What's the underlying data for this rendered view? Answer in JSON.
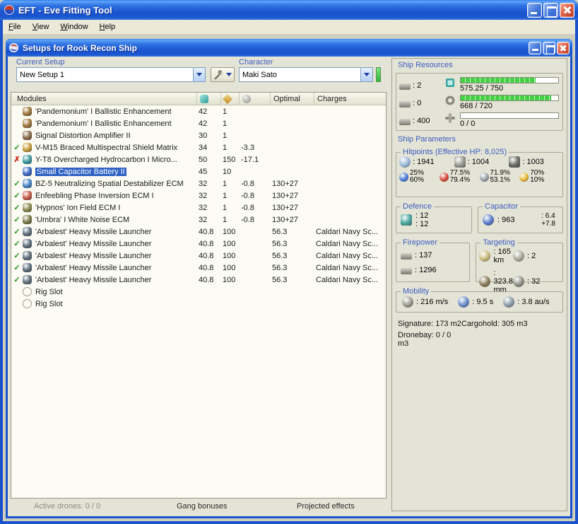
{
  "colors": {
    "selection": "#2F62C4",
    "ok": "#189418",
    "bad": "#C82814",
    "bargreen": "#44D044",
    "labelblue": "#3C5CC0"
  },
  "window": {
    "title": "EFT - Eve Fitting Tool"
  },
  "menu": {
    "items": [
      {
        "label": "File"
      },
      {
        "label": "View"
      },
      {
        "label": "Window"
      },
      {
        "label": "Help"
      }
    ]
  },
  "setup_window": {
    "title": "Setups for Rook Recon Ship",
    "current_setup": {
      "label": "Current Setup",
      "value": "New Setup 1"
    },
    "character": {
      "label": "Character",
      "value": "Maki Sato"
    }
  },
  "modules": {
    "headers": {
      "name": "Modules",
      "optimal": "Optimal",
      "charges": "Charges"
    },
    "status_glyphs": {
      "ok": "✓",
      "bad": "✗"
    },
    "rows": [
      {
        "status": "",
        "icon": "module-icon",
        "icon_color": "#A0783C",
        "name": "'Pandemonium' I Ballistic Enhancement",
        "cpu": "42",
        "pg": "1",
        "cap": "",
        "optimal": "",
        "charges": "",
        "selected": false
      },
      {
        "status": "",
        "icon": "module-icon",
        "icon_color": "#A0783C",
        "name": "'Pandemonium' I Ballistic Enhancement",
        "cpu": "42",
        "pg": "1",
        "cap": "",
        "optimal": "",
        "charges": "",
        "selected": false
      },
      {
        "status": "",
        "icon": "module-icon",
        "icon_color": "#8A6A4A",
        "name": "Signal Distortion Amplifier II",
        "cpu": "30",
        "pg": "1",
        "cap": "",
        "optimal": "",
        "charges": "",
        "selected": false
      },
      {
        "status": "ok",
        "icon": "module-icon",
        "icon_color": "#C8A23C",
        "name": "V-M15 Braced Multispectral Shield Matrix",
        "cpu": "34",
        "pg": "1",
        "cap": "-3.3",
        "optimal": "",
        "charges": "",
        "selected": false
      },
      {
        "status": "bad",
        "icon": "module-icon",
        "icon_color": "#3C9AA0",
        "name": "Y-T8 Overcharged Hydrocarbon I Micro...",
        "cpu": "50",
        "pg": "150",
        "cap": "-17.1",
        "optimal": "",
        "charges": "",
        "selected": false
      },
      {
        "status": "",
        "icon": "module-icon",
        "icon_color": "#3C6AC8",
        "name": "Small Capacitor Battery II",
        "cpu": "45",
        "pg": "10",
        "cap": "",
        "optimal": "",
        "charges": "",
        "selected": true
      },
      {
        "status": "ok",
        "icon": "module-icon",
        "icon_color": "#4A88C8",
        "name": "BZ-5 Neutralizing Spatial Destabilizer ECM",
        "cpu": "32",
        "pg": "1",
        "cap": "-0.8",
        "optimal": "130+27",
        "charges": "",
        "selected": false
      },
      {
        "status": "ok",
        "icon": "module-icon",
        "icon_color": "#C85A4A",
        "name": "Enfeebling Phase Inversion ECM I",
        "cpu": "32",
        "pg": "1",
        "cap": "-0.8",
        "optimal": "130+27",
        "charges": "",
        "selected": false
      },
      {
        "status": "ok",
        "icon": "module-icon",
        "icon_color": "#8A8A50",
        "name": "'Hypnos' Ion Field ECM I",
        "cpu": "32",
        "pg": "1",
        "cap": "-0.8",
        "optimal": "130+27",
        "charges": "",
        "selected": false
      },
      {
        "status": "ok",
        "icon": "module-icon",
        "icon_color": "#7A7A4A",
        "name": "'Umbra' I White Noise ECM",
        "cpu": "32",
        "pg": "1",
        "cap": "-0.8",
        "optimal": "130+27",
        "charges": "",
        "selected": false
      },
      {
        "status": "ok",
        "icon": "module-icon",
        "icon_color": "#607080",
        "name": "'Arbalest' Heavy Missile Launcher",
        "cpu": "40.8",
        "pg": "100",
        "cap": "",
        "optimal": "56.3",
        "charges": "Caldari Navy Sc...",
        "selected": false
      },
      {
        "status": "ok",
        "icon": "module-icon",
        "icon_color": "#607080",
        "name": "'Arbalest' Heavy Missile Launcher",
        "cpu": "40.8",
        "pg": "100",
        "cap": "",
        "optimal": "56.3",
        "charges": "Caldari Navy Sc...",
        "selected": false
      },
      {
        "status": "ok",
        "icon": "module-icon",
        "icon_color": "#607080",
        "name": "'Arbalest' Heavy Missile Launcher",
        "cpu": "40.8",
        "pg": "100",
        "cap": "",
        "optimal": "56.3",
        "charges": "Caldari Navy Sc...",
        "selected": false
      },
      {
        "status": "ok",
        "icon": "module-icon",
        "icon_color": "#607080",
        "name": "'Arbalest' Heavy Missile Launcher",
        "cpu": "40.8",
        "pg": "100",
        "cap": "",
        "optimal": "56.3",
        "charges": "Caldari Navy Sc...",
        "selected": false
      },
      {
        "status": "ok",
        "icon": "module-icon",
        "icon_color": "#607080",
        "name": "'Arbalest' Heavy Missile Launcher",
        "cpu": "40.8",
        "pg": "100",
        "cap": "",
        "optimal": "56.3",
        "charges": "Caldari Navy Sc...",
        "selected": false
      },
      {
        "status": "",
        "icon": "rig-slot-icon",
        "icon_color": "",
        "name": "Rig Slot",
        "cpu": "",
        "pg": "",
        "cap": "",
        "optimal": "",
        "charges": "",
        "selected": false
      },
      {
        "status": "",
        "icon": "rig-slot-icon",
        "icon_color": "",
        "name": "Rig Slot",
        "cpu": "",
        "pg": "",
        "cap": "",
        "optimal": "",
        "charges": "",
        "selected": false
      }
    ]
  },
  "ship_resources": {
    "label": "Ship Resources",
    "hardpoints": [
      {
        "icon": "turret-hardpoints-icon",
        "value": ": 2"
      },
      {
        "icon": "launcher-hardpoints-icon",
        "value": ": 0"
      },
      {
        "icon": "calibration-icon",
        "value": ": 400"
      }
    ],
    "bars": [
      {
        "icon": "cpu-icon",
        "text": "575.25 / 750",
        "percent": 76.7
      },
      {
        "icon": "powergrid-icon",
        "text": "668 / 720",
        "percent": 92.8
      },
      {
        "icon": "drone-bandwidth-icon",
        "text": "0 / 0",
        "percent": 0
      }
    ]
  },
  "ship_parameters": {
    "label": "Ship Parameters",
    "hitpoints": {
      "label": "Hitpoints (Effective HP: 8,025)",
      "pools": [
        {
          "icon": "shield-icon",
          "value": ": 1941"
        },
        {
          "icon": "armor-icon",
          "value": ": 1004"
        },
        {
          "icon": "structure-icon",
          "value": ": 1003"
        }
      ],
      "resists": [
        {
          "icon": "em-resist-icon",
          "top": "25%",
          "bottom": "60%"
        },
        {
          "icon": "thermal-resist-icon",
          "top": "77.5%",
          "bottom": "79.4%"
        },
        {
          "icon": "kinetic-resist-icon",
          "top": "71.9%",
          "bottom": "53.1%"
        },
        {
          "icon": "explosive-resist-icon",
          "top": "70%",
          "bottom": "10%"
        }
      ]
    },
    "defence": {
      "label": "Defence",
      "top": ": 12",
      "bottom": ": 12"
    },
    "capacitor": {
      "label": "Capacitor",
      "value": ": 963",
      "delta_top": ": 6.4",
      "delta_bottom": "+7.8"
    },
    "firepower": {
      "label": "Firepower",
      "turret": ": 137",
      "launcher": ": 1296"
    },
    "targeting": {
      "label": "Targeting",
      "range": ": 165 km",
      "max_targets": ": 2",
      "scan_res": ": 323.8 mm",
      "sensor": ": 32"
    },
    "mobility": {
      "label": "Mobility",
      "speed": ": 216 m/s",
      "align": ": 9.5 s",
      "warp": ": 3.8 au/s"
    },
    "signature": "Signature: 173 m2",
    "cargohold": "Cargohold: 305 m3",
    "dronebay": "Dronebay: 0 / 0 m3"
  },
  "footer": {
    "active_drones": "Active drones: 0 / 0",
    "gang_bonuses": "Gang bonuses",
    "projected_effects": "Projected effects"
  }
}
